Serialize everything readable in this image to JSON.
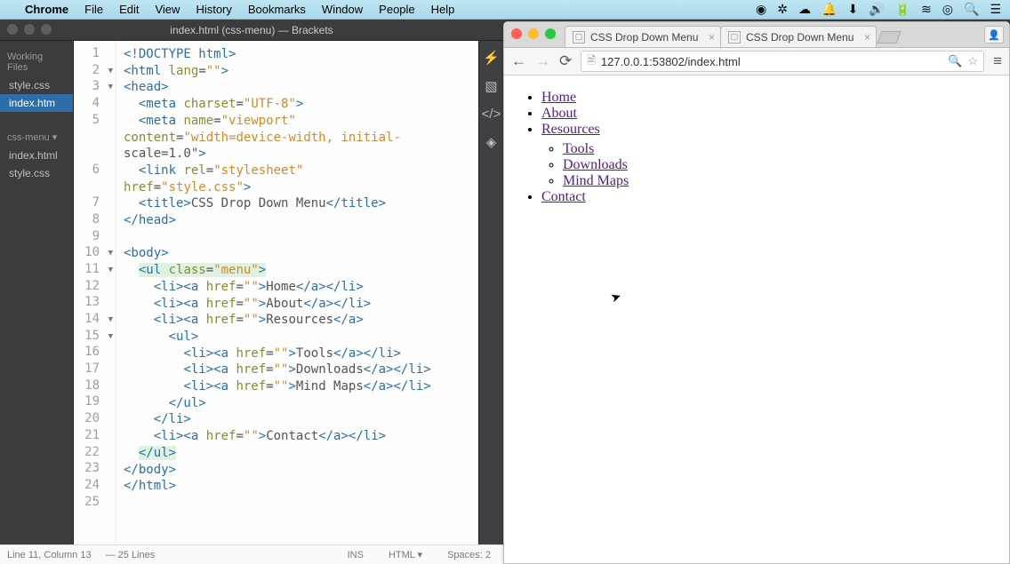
{
  "menubar": {
    "apple": "",
    "app": "Chrome",
    "items": [
      "File",
      "Edit",
      "View",
      "History",
      "Bookmarks",
      "Window",
      "People",
      "Help"
    ],
    "right_icons": [
      "◉",
      "✲",
      "☁",
      "🔔",
      "⬇",
      "🔊",
      "🔋",
      "≋",
      "◎",
      "🔍",
      "☰"
    ]
  },
  "brackets": {
    "title": "index.html (css-menu) — Brackets",
    "sidebar": {
      "working_label": "Working Files",
      "working": [
        {
          "name": "style.css",
          "active": false
        },
        {
          "name": "index.htm",
          "active": true
        }
      ],
      "project_label": "css-menu ▾",
      "project": [
        {
          "name": "index.html"
        },
        {
          "name": "style.css"
        }
      ]
    },
    "code_lines": [
      {
        "n": 1,
        "fold": false,
        "html": "<span class='t-tag'>&lt;!DOCTYPE html&gt;</span>"
      },
      {
        "n": 2,
        "fold": true,
        "html": "<span class='t-tag'>&lt;html</span> <span class='t-attr'>lang</span>=<span class='t-str'>\"\"</span><span class='t-tag'>&gt;</span>"
      },
      {
        "n": 3,
        "fold": true,
        "html": "<span class='t-tag'>&lt;head&gt;</span>"
      },
      {
        "n": 4,
        "fold": false,
        "html": "  <span class='t-tag'>&lt;meta</span> <span class='t-attr'>charset</span>=<span class='t-str'>\"UTF-8\"</span><span class='t-tag'>&gt;</span>"
      },
      {
        "n": 5,
        "fold": false,
        "html": "  <span class='t-tag'>&lt;meta</span> <span class='t-attr'>name</span>=<span class='t-str'>\"viewport\"</span> \n<span class='t-attr'>content</span>=<span class='t-str'>\"width=device-width, initial-\nscale=1.0\"</span><span class='t-tag'>&gt;</span>"
      },
      {
        "n": 6,
        "fold": false,
        "html": "  <span class='t-tag'>&lt;link</span> <span class='t-attr'>rel</span>=<span class='t-str'>\"stylesheet\"</span> \n<span class='t-attr'>href</span>=<span class='t-str'>\"style.css\"</span><span class='t-tag'>&gt;</span>"
      },
      {
        "n": 7,
        "fold": false,
        "html": "  <span class='t-tag'>&lt;title&gt;</span><span class='t-text'>CSS Drop Down Menu</span><span class='t-tag'>&lt;/title&gt;</span>"
      },
      {
        "n": 8,
        "fold": false,
        "html": "<span class='t-tag'>&lt;/head&gt;</span>"
      },
      {
        "n": 9,
        "fold": false,
        "html": ""
      },
      {
        "n": 10,
        "fold": true,
        "html": "<span class='t-tag'>&lt;body&gt;</span>"
      },
      {
        "n": 11,
        "fold": true,
        "html": "  <span class='t-hl'><span class='t-tag'>&lt;ul</span> <span class='t-attr'>class</span>=<span class='t-str'>\"menu\"</span><span class='t-tag'>&gt;</span></span>"
      },
      {
        "n": 12,
        "fold": false,
        "html": "    <span class='t-tag'>&lt;li&gt;&lt;a</span> <span class='t-attr'>href</span>=<span class='t-str'>\"\"</span><span class='t-tag'>&gt;</span><span class='t-text'>Home</span><span class='t-tag'>&lt;/a&gt;&lt;/li&gt;</span>"
      },
      {
        "n": 13,
        "fold": false,
        "html": "    <span class='t-tag'>&lt;li&gt;&lt;a</span> <span class='t-attr'>href</span>=<span class='t-str'>\"\"</span><span class='t-tag'>&gt;</span><span class='t-text'>About</span><span class='t-tag'>&lt;/a&gt;&lt;/li&gt;</span>"
      },
      {
        "n": 14,
        "fold": true,
        "html": "    <span class='t-tag'>&lt;li&gt;&lt;a</span> <span class='t-attr'>href</span>=<span class='t-str'>\"\"</span><span class='t-tag'>&gt;</span><span class='t-text'>Resources</span><span class='t-tag'>&lt;/a&gt;</span>"
      },
      {
        "n": 15,
        "fold": true,
        "html": "      <span class='t-tag'>&lt;ul&gt;</span>"
      },
      {
        "n": 16,
        "fold": false,
        "html": "        <span class='t-tag'>&lt;li&gt;&lt;a</span> <span class='t-attr'>href</span>=<span class='t-str'>\"\"</span><span class='t-tag'>&gt;</span><span class='t-text'>Tools</span><span class='t-tag'>&lt;/a&gt;&lt;/li&gt;</span>"
      },
      {
        "n": 17,
        "fold": false,
        "html": "        <span class='t-tag'>&lt;li&gt;&lt;a</span> <span class='t-attr'>href</span>=<span class='t-str'>\"\"</span><span class='t-tag'>&gt;</span><span class='t-text'>Downloads</span><span class='t-tag'>&lt;/a&gt;&lt;/li&gt;</span>"
      },
      {
        "n": 18,
        "fold": false,
        "html": "        <span class='t-tag'>&lt;li&gt;&lt;a</span> <span class='t-attr'>href</span>=<span class='t-str'>\"\"</span><span class='t-tag'>&gt;</span><span class='t-text'>Mind Maps</span><span class='t-tag'>&lt;/a&gt;&lt;/li&gt;</span>"
      },
      {
        "n": 19,
        "fold": false,
        "html": "      <span class='t-tag'>&lt;/ul&gt;</span>"
      },
      {
        "n": 20,
        "fold": false,
        "html": "    <span class='t-tag'>&lt;/li&gt;</span>"
      },
      {
        "n": 21,
        "fold": false,
        "html": "    <span class='t-tag'>&lt;li&gt;&lt;a</span> <span class='t-attr'>href</span>=<span class='t-str'>\"\"</span><span class='t-tag'>&gt;</span><span class='t-text'>Contact</span><span class='t-tag'>&lt;/a&gt;&lt;/li&gt;</span>"
      },
      {
        "n": 22,
        "fold": false,
        "html": "  <span class='t-hl'><span class='t-tag'>&lt;/ul&gt;</span></span>"
      },
      {
        "n": 23,
        "fold": false,
        "html": "<span class='t-tag'>&lt;/body&gt;</span>"
      },
      {
        "n": 24,
        "fold": false,
        "html": "<span class='t-tag'>&lt;/html&gt;</span>"
      },
      {
        "n": 25,
        "fold": false,
        "html": ""
      }
    ],
    "status": {
      "pos": "Line 11, Column 13",
      "lines": "— 25 Lines",
      "ins": "INS",
      "lang": "HTML ▾",
      "spaces": "Spaces: 2"
    },
    "iconbar": {
      "bolt": "⚡",
      "ext": "▧",
      "code": "</>",
      "cube": "◈"
    }
  },
  "chrome": {
    "tabs": [
      {
        "title": "CSS Drop Down Menu"
      },
      {
        "title": "CSS Drop Down Menu"
      }
    ],
    "url": "127.0.0.1:53802/index.html",
    "nav": {
      "home": "Home",
      "about": "About",
      "resources": "Resources",
      "tools": "Tools",
      "downloads": "Downloads",
      "mindmaps": "Mind Maps",
      "contact": "Contact"
    }
  }
}
